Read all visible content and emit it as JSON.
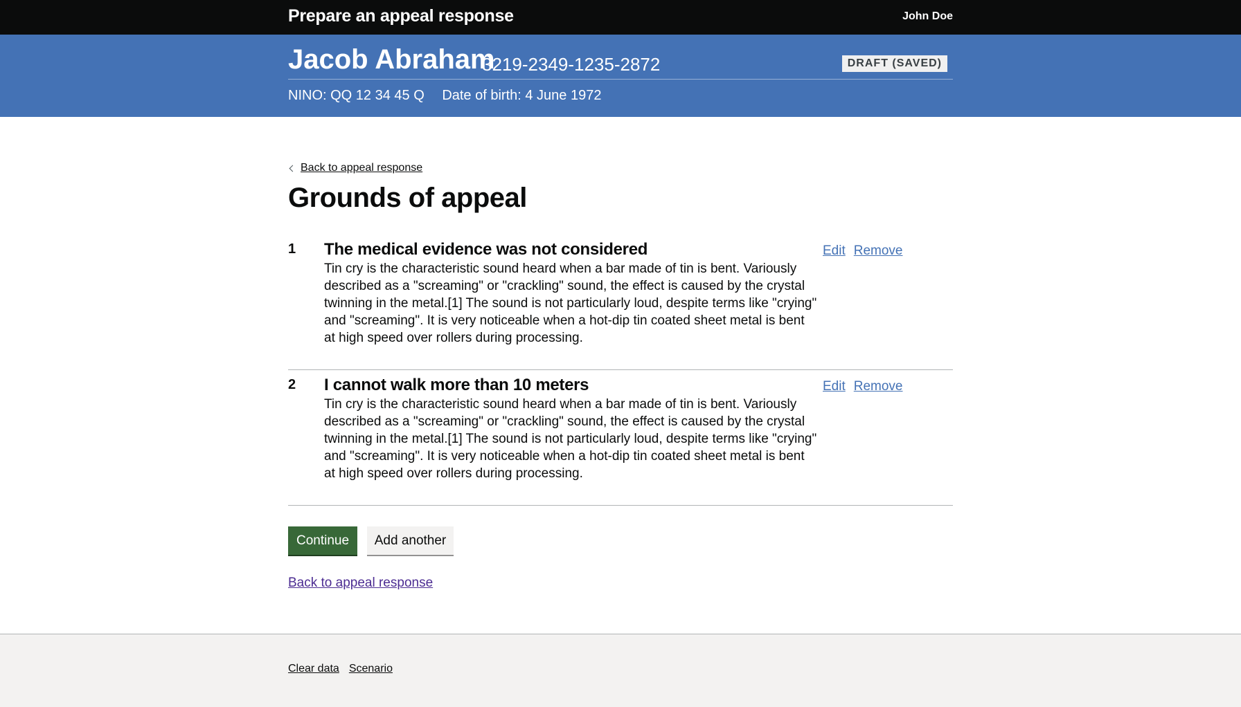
{
  "header": {
    "service_name": "Prepare an appeal response",
    "user_name": "John Doe"
  },
  "banner": {
    "person_name": "Jacob Abraham",
    "reference": "3219-2349-1235-2872",
    "status": "DRAFT (SAVED)",
    "nino": "NINO: QQ 12 34 45 Q",
    "dob": "Date of birth: 4 June 1972"
  },
  "back_link_top": "Back to appeal response",
  "page_title": "Grounds of appeal",
  "grounds": [
    {
      "number": "1",
      "title": "The medical evidence was not considered",
      "description": "Tin cry is the characteristic sound heard when a bar made of tin is bent. Variously described as a \"screaming\" or \"crackling\" sound, the effect is caused by the crystal twinning in the metal.[1] The sound is not particularly loud, despite terms like \"crying\" and \"screaming\". It is very noticeable when a hot-dip tin coated sheet metal is bent at high speed over rollers during processing.",
      "edit_label": "Edit",
      "remove_label": "Remove"
    },
    {
      "number": "2",
      "title": "I cannot walk more than 10 meters",
      "description": "Tin cry is the characteristic sound heard when a bar made of tin is bent. Variously described as a \"screaming\" or \"crackling\" sound, the effect is caused by the crystal twinning in the metal.[1] The sound is not particularly loud, despite terms like \"crying\" and \"screaming\". It is very noticeable when a hot-dip tin coated sheet metal is bent at high speed over rollers during processing.",
      "edit_label": "Edit",
      "remove_label": "Remove"
    }
  ],
  "buttons": {
    "continue": "Continue",
    "add_another": "Add another"
  },
  "back_link_bottom": "Back to appeal response",
  "footer": {
    "clear_data": "Clear data",
    "scenario": "Scenario"
  },
  "colors": {
    "header_bg": "#0b0c0c",
    "banner_bg": "#4472b5",
    "continue_bg": "#386838",
    "link": "#4472b5",
    "visited_link": "#4c2c92"
  }
}
